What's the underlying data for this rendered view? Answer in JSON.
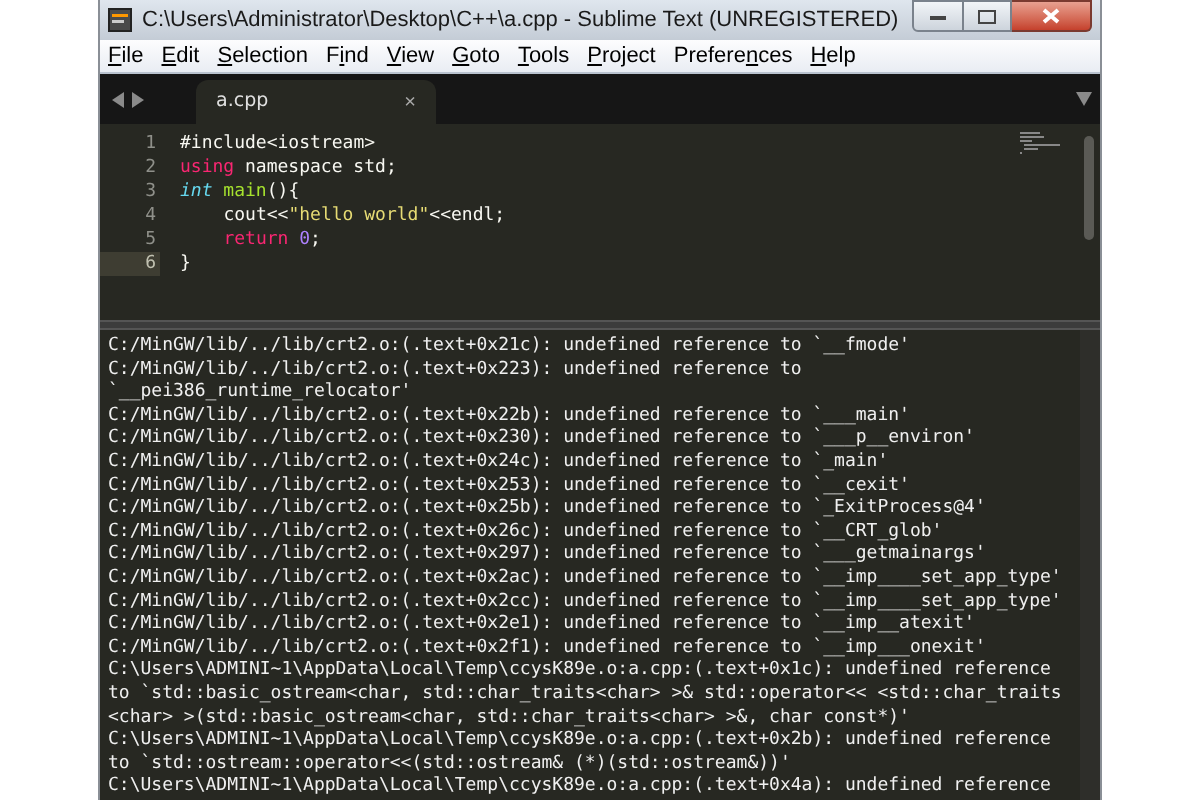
{
  "window": {
    "title": "C:\\Users\\Administrator\\Desktop\\C++\\a.cpp - Sublime Text (UNREGISTERED)"
  },
  "menu": [
    {
      "parts": [
        {
          "text": "F",
          "underlined": true
        },
        {
          "text": "ile",
          "underlined": false
        }
      ]
    },
    {
      "parts": [
        {
          "text": "E",
          "underlined": true
        },
        {
          "text": "dit",
          "underlined": false
        }
      ]
    },
    {
      "parts": [
        {
          "text": "S",
          "underlined": true
        },
        {
          "text": "election",
          "underlined": false
        }
      ]
    },
    {
      "parts": [
        {
          "text": "F",
          "underlined": false
        },
        {
          "text": "i",
          "underlined": true
        },
        {
          "text": "nd",
          "underlined": false
        }
      ]
    },
    {
      "parts": [
        {
          "text": "V",
          "underlined": true
        },
        {
          "text": "iew",
          "underlined": false
        }
      ]
    },
    {
      "parts": [
        {
          "text": "G",
          "underlined": true
        },
        {
          "text": "oto",
          "underlined": false
        }
      ]
    },
    {
      "parts": [
        {
          "text": "T",
          "underlined": true
        },
        {
          "text": "ools",
          "underlined": false
        }
      ]
    },
    {
      "parts": [
        {
          "text": "P",
          "underlined": true
        },
        {
          "text": "roject",
          "underlined": false
        }
      ]
    },
    {
      "parts": [
        {
          "text": "Prefere",
          "underlined": false
        },
        {
          "text": "n",
          "underlined": true
        },
        {
          "text": "ces",
          "underlined": false
        }
      ]
    },
    {
      "parts": [
        {
          "text": "H",
          "underlined": true
        },
        {
          "text": "elp",
          "underlined": false
        }
      ]
    }
  ],
  "tabs": [
    {
      "label": "a.cpp",
      "selected": true,
      "close": "×"
    }
  ],
  "editor": {
    "lines": [
      {
        "number": "1",
        "current": false,
        "indent": false,
        "tokens": [
          {
            "kind": "plain",
            "space_before": false,
            "text": "#include<iostream>"
          }
        ]
      },
      {
        "number": "2",
        "current": false,
        "indent": false,
        "tokens": [
          {
            "kind": "keyword",
            "space_before": false,
            "text": "using"
          },
          {
            "kind": "plain",
            "space_before": true,
            "text": "namespace std;"
          }
        ]
      },
      {
        "number": "3",
        "current": false,
        "indent": false,
        "tokens": [
          {
            "kind": "type",
            "space_before": false,
            "text": "int"
          },
          {
            "kind": "function",
            "space_before": true,
            "text": "main"
          },
          {
            "kind": "plain",
            "space_before": false,
            "text": "(){"
          }
        ]
      },
      {
        "number": "4",
        "current": false,
        "indent": true,
        "tokens": [
          {
            "kind": "plain",
            "space_before": false,
            "text": "cout<<"
          },
          {
            "kind": "string",
            "space_before": false,
            "text": "\"hello world\""
          },
          {
            "kind": "plain",
            "space_before": false,
            "text": "<<endl;"
          }
        ]
      },
      {
        "number": "5",
        "current": false,
        "indent": true,
        "tokens": [
          {
            "kind": "keyword",
            "space_before": false,
            "text": "return"
          },
          {
            "kind": "number",
            "space_before": true,
            "text": "0"
          },
          {
            "kind": "plain",
            "space_before": false,
            "text": ";"
          }
        ]
      },
      {
        "number": "6",
        "current": true,
        "indent": false,
        "tokens": [
          {
            "kind": "plain",
            "space_before": false,
            "text": "}"
          }
        ]
      }
    ]
  },
  "output": {
    "lines": [
      "C:/MinGW/lib/../lib/crt2.o:(.text+0x21c): undefined reference to `__fmode'",
      "C:/MinGW/lib/../lib/crt2.o:(.text+0x223): undefined reference to",
      "`__pei386_runtime_relocator'",
      "C:/MinGW/lib/../lib/crt2.o:(.text+0x22b): undefined reference to `___main'",
      "C:/MinGW/lib/../lib/crt2.o:(.text+0x230): undefined reference to `___p__environ'",
      "C:/MinGW/lib/../lib/crt2.o:(.text+0x24c): undefined reference to `_main'",
      "C:/MinGW/lib/../lib/crt2.o:(.text+0x253): undefined reference to `__cexit'",
      "C:/MinGW/lib/../lib/crt2.o:(.text+0x25b): undefined reference to `_ExitProcess@4'",
      "C:/MinGW/lib/../lib/crt2.o:(.text+0x26c): undefined reference to `__CRT_glob'",
      "C:/MinGW/lib/../lib/crt2.o:(.text+0x297): undefined reference to `___getmainargs'",
      "C:/MinGW/lib/../lib/crt2.o:(.text+0x2ac): undefined reference to `__imp____set_app_type'",
      "C:/MinGW/lib/../lib/crt2.o:(.text+0x2cc): undefined reference to `__imp____set_app_type'",
      "C:/MinGW/lib/../lib/crt2.o:(.text+0x2e1): undefined reference to `__imp__atexit'",
      "C:/MinGW/lib/../lib/crt2.o:(.text+0x2f1): undefined reference to `__imp___onexit'",
      "C:\\Users\\ADMINI~1\\AppData\\Local\\Temp\\ccysK89e.o:a.cpp:(.text+0x1c): undefined reference",
      "to `std::basic_ostream<char, std::char_traits<char> >& std::operator<< <std::char_traits",
      "<char> >(std::basic_ostream<char, std::char_traits<char> >&, char const*)'",
      "C:\\Users\\ADMINI~1\\AppData\\Local\\Temp\\ccysK89e.o:a.cpp:(.text+0x2b): undefined reference",
      "to `std::ostream::operator<<(std::ostream& (*)(std::ostream&))'",
      "C:\\Users\\ADMINI~1\\AppData\\Local\\Temp\\ccysK89e.o:a.cpp:(.text+0x4a): undefined reference"
    ]
  }
}
